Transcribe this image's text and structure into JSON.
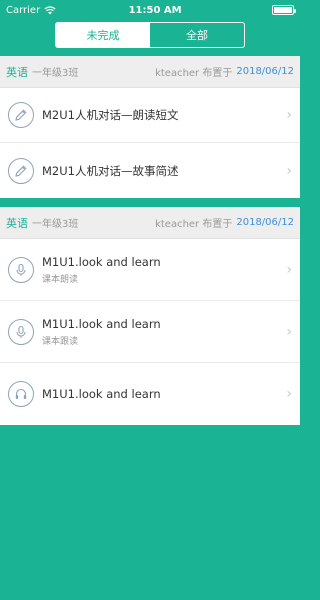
{
  "status_bar": {
    "carrier": "Carrier",
    "time": "11:50 AM"
  },
  "tabs": [
    {
      "label": "未完成",
      "active": true
    },
    {
      "label": "全部",
      "active": false
    }
  ],
  "groups": [
    {
      "subject": "英语",
      "class_name": "一年级3班",
      "teacher": "kteacher 布置于",
      "date": "2018/06/12",
      "items": [
        {
          "icon": "edit-icon",
          "title": "M2U1人机对话—朗读短文",
          "subtitle": ""
        },
        {
          "icon": "edit-icon",
          "title": "M2U1人机对话—故事简述",
          "subtitle": ""
        }
      ]
    },
    {
      "subject": "英语",
      "class_name": "一年级3班",
      "teacher": "kteacher 布置于",
      "date": "2018/06/12",
      "items": [
        {
          "icon": "microphone-icon",
          "title": "M1U1.look and learn",
          "subtitle": "课本朗读"
        },
        {
          "icon": "microphone-icon",
          "title": "M1U1.look and learn",
          "subtitle": "课本跟读"
        },
        {
          "icon": "headphones-icon",
          "title": "M1U1.look and learn",
          "subtitle": ""
        }
      ]
    }
  ],
  "colors": {
    "accent": "#1ab394",
    "date": "#3f8fd8",
    "header_bg": "#eeeeee"
  }
}
